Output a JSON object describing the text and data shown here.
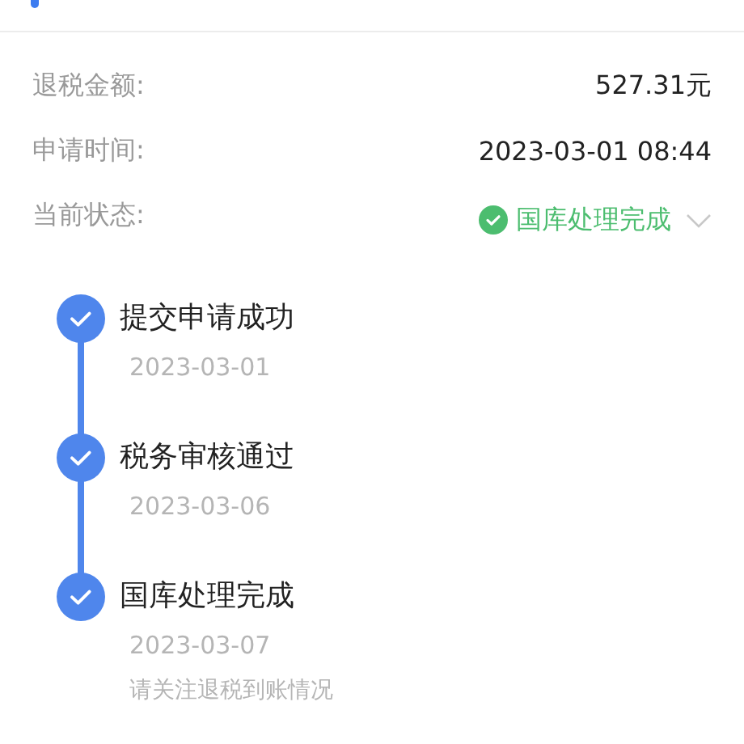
{
  "details": [
    {
      "label": "退税金额:",
      "value": "527.31元",
      "kind": "text"
    },
    {
      "label": "申请时间:",
      "value": "2023-03-01 08:44",
      "kind": "text"
    },
    {
      "label": "当前状态:",
      "value": "国库处理完成",
      "kind": "status"
    }
  ],
  "steps": [
    {
      "title": "提交申请成功",
      "date": "2023-03-01",
      "done": true
    },
    {
      "title": "税务审核通过",
      "date": "2023-03-06",
      "done": true
    },
    {
      "title": "国库处理完成",
      "date": "2023-03-07",
      "note": "请关注退税到账情况",
      "done": true
    }
  ]
}
